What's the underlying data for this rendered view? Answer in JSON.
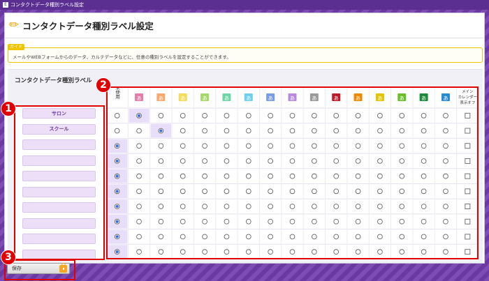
{
  "window": {
    "title": "コンタクトデータ種別ラベル設定"
  },
  "page": {
    "title": "コンタクトデータ種別ラベル設定"
  },
  "guide": {
    "tag": "ガイド",
    "text": "メールやWEBフォームからのデータ、カルテデータなどに、任意の種別ラベルを設定することができます。"
  },
  "section": {
    "title": "コンタクトデータ種別ラベル"
  },
  "rows": [
    {
      "name": "サロン",
      "selected": 1
    },
    {
      "name": "スクール",
      "selected": 2
    },
    {
      "name": "",
      "selected": 0
    },
    {
      "name": "",
      "selected": 0
    },
    {
      "name": "",
      "selected": 0
    },
    {
      "name": "",
      "selected": 0
    },
    {
      "name": "",
      "selected": 0
    },
    {
      "name": "",
      "selected": 0
    },
    {
      "name": "",
      "selected": 0
    },
    {
      "name": "",
      "selected": 0
    }
  ],
  "columns": {
    "first": "未使用",
    "last": "メインカレンダー表示オフ",
    "labels": [
      {
        "glyph": "あ",
        "color": "#e87aa8"
      },
      {
        "glyph": "あ",
        "color": "#f5a96b"
      },
      {
        "glyph": "あ",
        "color": "#f2dc5a"
      },
      {
        "glyph": "あ",
        "color": "#a6d86a"
      },
      {
        "glyph": "あ",
        "color": "#6fd6a8"
      },
      {
        "glyph": "あ",
        "color": "#6ecff0"
      },
      {
        "glyph": "あ",
        "color": "#7a9be8"
      },
      {
        "glyph": "あ",
        "color": "#b78ae0"
      },
      {
        "glyph": "あ",
        "color": "#9a9a9a"
      },
      {
        "glyph": "あ",
        "color": "#c0192a"
      },
      {
        "glyph": "あ",
        "color": "#f08a00"
      },
      {
        "glyph": "あ",
        "color": "#e2c400"
      },
      {
        "glyph": "あ",
        "color": "#6bc02a"
      },
      {
        "glyph": "あ",
        "color": "#1d8a3a"
      },
      {
        "glyph": "あ",
        "color": "#2a8ad0"
      }
    ]
  },
  "markers": [
    "1",
    "2",
    "3"
  ],
  "save": {
    "label": "保存"
  }
}
